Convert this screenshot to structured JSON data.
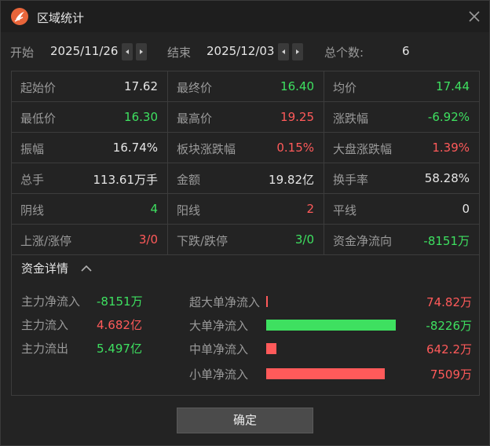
{
  "window": {
    "title": "区域统计",
    "icon": "app-logo-icon"
  },
  "range": {
    "start_label": "开始",
    "start_date": "2025/11/26",
    "end_label": "结束",
    "end_date": "2025/12/03",
    "count_label": "总个数:",
    "count_value": "6"
  },
  "stats": [
    [
      {
        "k": "起始价",
        "v": "17.62",
        "tone": "neu"
      },
      {
        "k": "最终价",
        "v": "16.40",
        "tone": "down"
      },
      {
        "k": "均价",
        "v": "17.44",
        "tone": "down"
      }
    ],
    [
      {
        "k": "最低价",
        "v": "16.30",
        "tone": "down"
      },
      {
        "k": "最高价",
        "v": "19.25",
        "tone": "up"
      },
      {
        "k": "涨跌幅",
        "v": "-6.92%",
        "tone": "down"
      }
    ],
    [
      {
        "k": "振幅",
        "v": "16.74%",
        "tone": "neu"
      },
      {
        "k": "板块涨跌幅",
        "v": "0.15%",
        "tone": "up"
      },
      {
        "k": "大盘涨跌幅",
        "v": "1.39%",
        "tone": "up"
      }
    ],
    [
      {
        "k": "总手",
        "v": "113.61万手",
        "tone": "neu"
      },
      {
        "k": "金额",
        "v": "19.82亿",
        "tone": "neu"
      },
      {
        "k": "换手率",
        "v": "58.28%",
        "tone": "neu"
      }
    ],
    [
      {
        "k": "阴线",
        "v": "4",
        "tone": "down"
      },
      {
        "k": "阳线",
        "v": "2",
        "tone": "up"
      },
      {
        "k": "平线",
        "v": "0",
        "tone": "neu"
      }
    ],
    [
      {
        "k": "上涨/涨停",
        "v": "3/0",
        "tone": "up"
      },
      {
        "k": "下跌/跌停",
        "v": "3/0",
        "tone": "down"
      },
      {
        "k": "资金净流向",
        "v": "-8151万",
        "tone": "down"
      }
    ]
  ],
  "fund": {
    "heading": "资金详情",
    "summary": [
      {
        "k": "主力净流入",
        "v": "-8151万",
        "tone": "down"
      },
      {
        "k": "主力流入",
        "v": "4.682亿",
        "tone": "up"
      },
      {
        "k": "主力流出",
        "v": "5.497亿",
        "tone": "down"
      }
    ],
    "flows": [
      {
        "k": "超大单净流入",
        "v": "74.82万",
        "tone": "up",
        "amount": 74.82
      },
      {
        "k": "大单净流入",
        "v": "-8226万",
        "tone": "down",
        "amount": -8226
      },
      {
        "k": "中单净流入",
        "v": "642.2万",
        "tone": "up",
        "amount": 642.2
      },
      {
        "k": "小单净流入",
        "v": "7509万",
        "tone": "up",
        "amount": 7509
      }
    ]
  },
  "ok_label": "确定",
  "colors": {
    "up": "#ff5a5a",
    "down": "#3ee060",
    "bg": "#232323",
    "accent": "#e8653a"
  }
}
